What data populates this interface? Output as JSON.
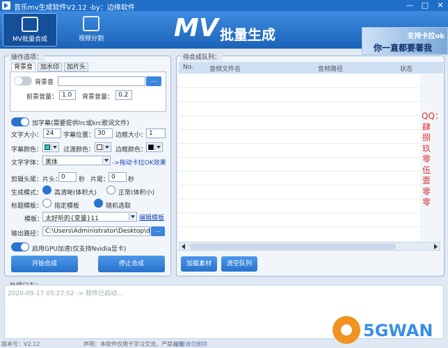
{
  "title": "音乐mv生成软件V2.12 -by：边缘软件",
  "toolbar": {
    "batch": "MV批量合成",
    "split": "视频分割"
  },
  "logo": {
    "mv": "MV",
    "text": "批量生成"
  },
  "banner": {
    "line1": "支持卡拉ok",
    "line2": "你一直都要著我"
  },
  "options": {
    "legend": "操作选项：",
    "tabs": [
      "背景音",
      "加水印",
      "加片头"
    ],
    "bgm_label": "背景音",
    "front_vol_label": "前景音量：",
    "front_vol": "1.0",
    "bg_vol_label": "背景音量：",
    "bg_vol": "0.2",
    "browse": "...",
    "subtitle_toggle": "加字幕(需要提供lrc或krc歌词文件)",
    "font_size_label": "文字大小：",
    "font_size": "24",
    "sub_pos_label": "字幕位置：",
    "sub_pos": "30",
    "border_size_label": "边框大小：",
    "border_size": "1",
    "sub_color_label": "字幕颜色：",
    "transition_color_label": "过渡颜色：",
    "border_color_label": "边框颜色：",
    "sub_color": "#22c8c8",
    "transition_color": "#ffffff",
    "border_color": "#000000",
    "font_label": "文字字体：",
    "font_value": "黑体",
    "karaoke_hint": "->拖动卡拉OK效果",
    "trim_label": "剪辑头尾：",
    "head_label": "片头：",
    "head_value": "0",
    "sec1": "秒",
    "tail_label": "片尾：",
    "tail_value": "0",
    "sec2": "秒",
    "mode_label": "生成模式：",
    "mode_hd": "高清晰(体积大)",
    "mode_normal": "正常(体积小)",
    "template_label": "标题模板：",
    "tpl_specified": "指定模板",
    "tpl_random": "随机选取",
    "tpl_name_label": "模板：",
    "tpl_name": "太好听的{变量}11",
    "edit_tpl": "编辑模板",
    "output_label": "输出路径：",
    "output_path": "C:\\Users\\Administrator\\Desktop\\dow",
    "gpu_toggle": "启用GPU加速(仅支持Nvidia显卡)",
    "start_btn": "开始合成",
    "stop_btn": "停止合成"
  },
  "queue": {
    "legend": "待合成队列：",
    "columns": [
      "No.",
      "音频文件名",
      "音频路径",
      "状态"
    ],
    "side_text": "QQ：肆捌玖零伍壹零零",
    "load_btn": "加载素材",
    "clear_btn": "清空队列"
  },
  "log": {
    "legend": "处理日志：",
    "line": "2020-09-17 05:27:02 -> 软件已启动..."
  },
  "status": {
    "version": "版本号：V2.12",
    "note": "声明：本软件仅用于学习交流，严禁商用",
    "link": "正则请勿删除"
  },
  "watermark": "5GWAN"
}
